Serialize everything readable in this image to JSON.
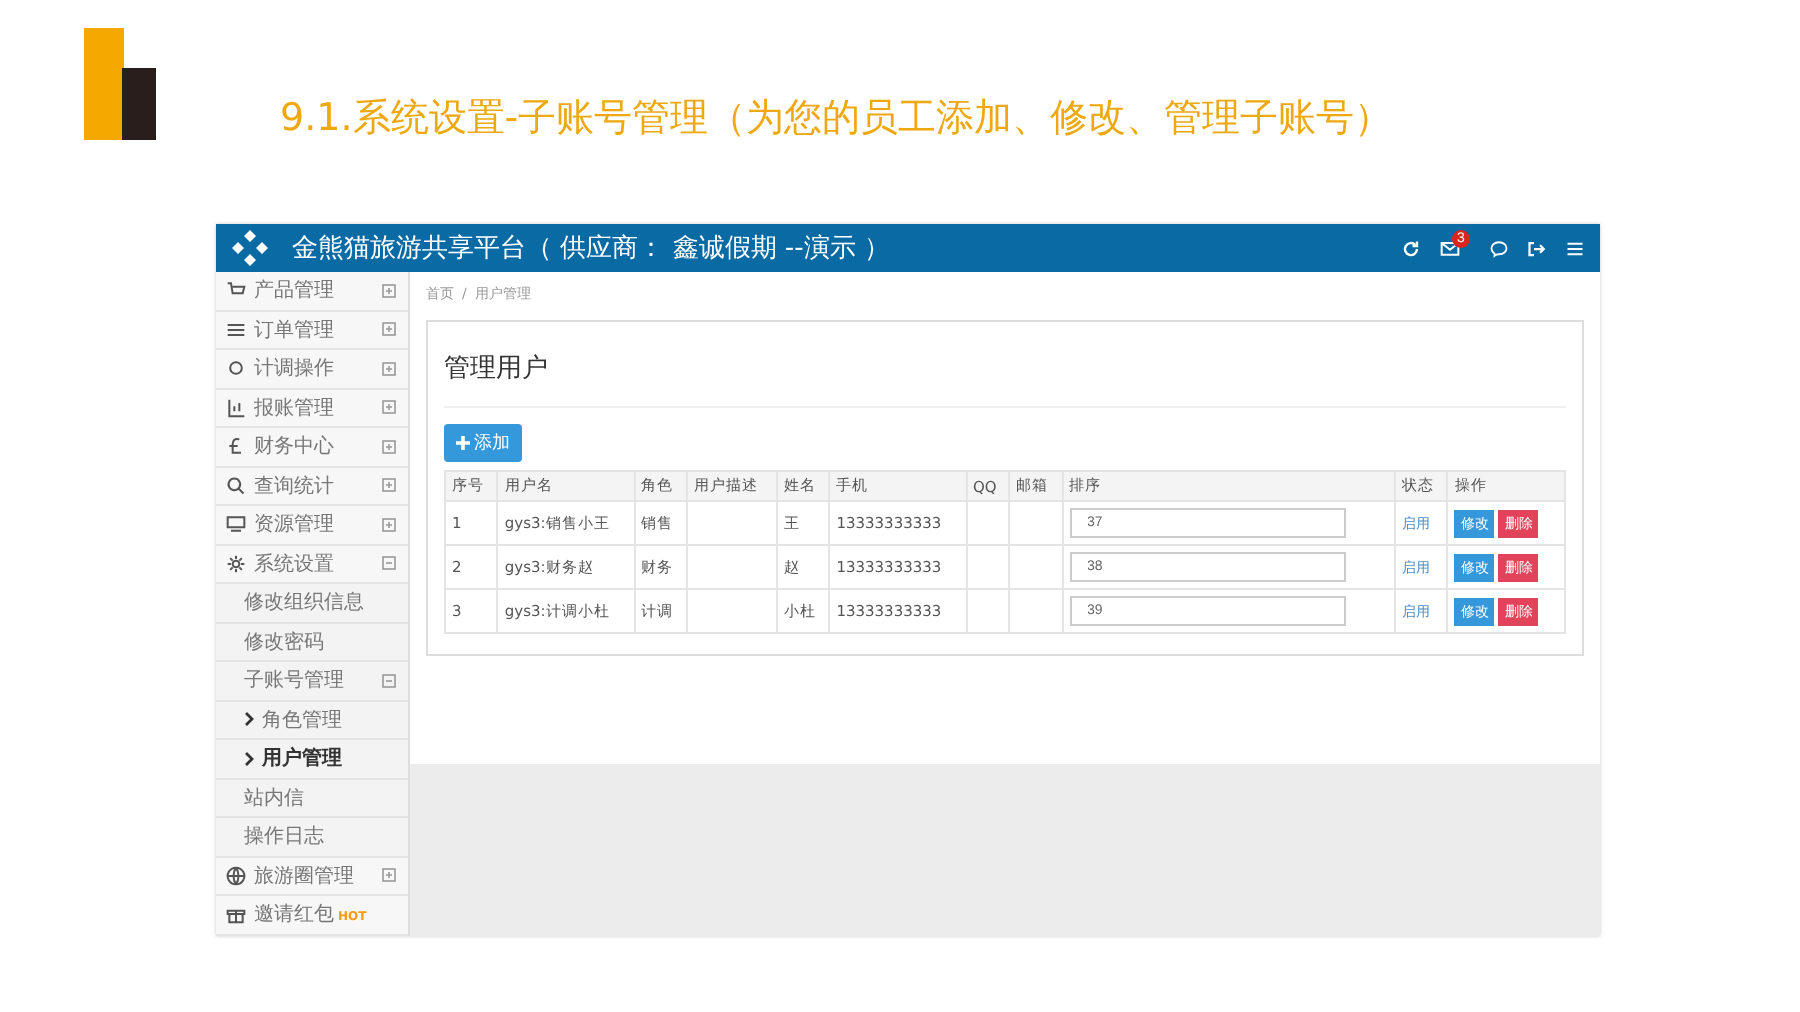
{
  "slide_title": "9.1.系统设置-子账号管理（为您的员工添加、修改、管理子账号）",
  "app": {
    "title": "金熊猫旅游共享平台（ 供应商： 鑫诚假期 --演示 ）",
    "notification_count": "3",
    "sidebar": [
      {
        "label": "产品管理",
        "expanded": false,
        "selected": false
      },
      {
        "label": "订单管理",
        "expanded": false,
        "selected": false
      },
      {
        "label": "计调操作",
        "expanded": false,
        "selected": false
      },
      {
        "label": "报账管理",
        "expanded": false,
        "selected": false
      },
      {
        "label": "财务中心",
        "expanded": false,
        "selected": false
      },
      {
        "label": "查询统计",
        "expanded": false,
        "selected": false
      },
      {
        "label": "资源管理",
        "expanded": false,
        "selected": false
      },
      {
        "label": "系统设置",
        "expanded": true,
        "selected": false,
        "children": [
          {
            "label": "修改组织信息",
            "selected": false
          },
          {
            "label": "修改密码",
            "selected": false
          },
          {
            "label": "子账号管理",
            "expanded": true,
            "selected": false,
            "children": [
              {
                "label": "角色管理",
                "selected": false
              },
              {
                "label": "用户管理",
                "selected": true
              }
            ]
          },
          {
            "label": "站内信",
            "selected": false
          },
          {
            "label": "操作日志",
            "selected": false
          }
        ]
      },
      {
        "label": "旅游圈管理",
        "expanded": false,
        "selected": false
      },
      {
        "label": "邀请红包",
        "badge": "HOT",
        "selected": false
      }
    ],
    "breadcrumb": [
      "首页",
      "用户管理"
    ],
    "breadcrumb_separator": "/",
    "panel_title": "管理用户",
    "add_button": "添加",
    "table": {
      "columns": [
        "序号",
        "用户名",
        "角色",
        "用户描述",
        "姓名",
        "手机",
        "QQ",
        "邮箱",
        "排序",
        "状态",
        "操作"
      ],
      "rows": [
        {
          "index": "1",
          "username": "gys3:销售小王",
          "role": "销售",
          "name": "王",
          "phone": "13333333333",
          "order": "37",
          "status": "启用",
          "edit": "修改",
          "delete": "删除"
        },
        {
          "index": "2",
          "username": "gys3:财务赵",
          "role": "财务",
          "name": "赵",
          "phone": "13333333333",
          "order": "38",
          "status": "启用",
          "edit": "修改",
          "delete": "删除"
        },
        {
          "index": "3",
          "username": "gys3:计调小杜",
          "role": "计调",
          "name": "小杜",
          "phone": "13333333333",
          "order": "39",
          "status": "启用",
          "edit": "修改",
          "delete": "删除"
        }
      ]
    }
  }
}
